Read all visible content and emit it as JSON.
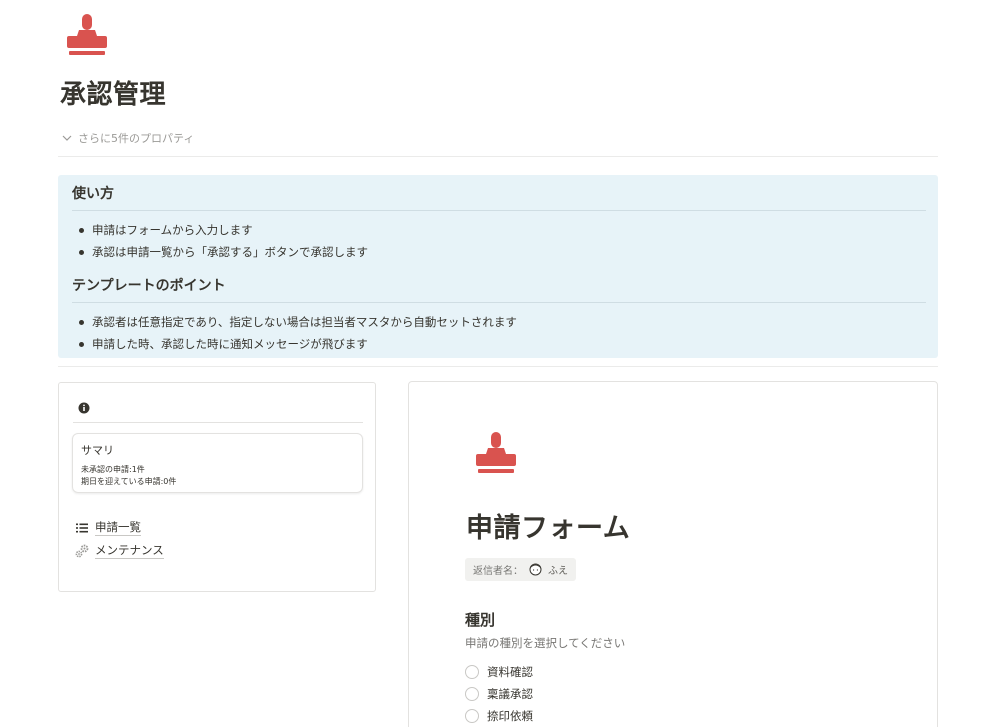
{
  "page": {
    "icon": "stamp-icon",
    "title": "承認管理",
    "properties_toggle": "さらに5件のプロパティ"
  },
  "colors": {
    "accent_red": "#d9534f",
    "callout_bg": "#e7f3f8",
    "text": "#37352f",
    "muted": "#9b9a97"
  },
  "callout": {
    "section1_title": "使い方",
    "section1_items": [
      "申請はフォームから入力します",
      "承認は申請一覧から「承認する」ボタンで承認します"
    ],
    "section2_title": "テンプレートのポイント",
    "section2_items": [
      "承認者は任意指定であり、指定しない場合は担当者マスタから自動セットされます",
      "申請した時、承認した時に通知メッセージが飛びます"
    ]
  },
  "sidebar": {
    "info_icon": "info-icon",
    "summary": {
      "title": "サマリ",
      "lines": [
        "未承認の申請:1件",
        "期日を迎えている申請:0件"
      ]
    },
    "links": [
      {
        "icon": "list-icon",
        "label": "申請一覧"
      },
      {
        "icon": "gears-icon",
        "label": "メンテナンス"
      }
    ]
  },
  "form": {
    "icon": "stamp-icon",
    "title": "申請フォーム",
    "sender_label": "返信者名：",
    "sender_name": "ふえ",
    "question_title": "種別",
    "question_desc": "申請の種別を選択してください",
    "options": [
      "資料確認",
      "稟議承認",
      "捺印依頼"
    ]
  }
}
